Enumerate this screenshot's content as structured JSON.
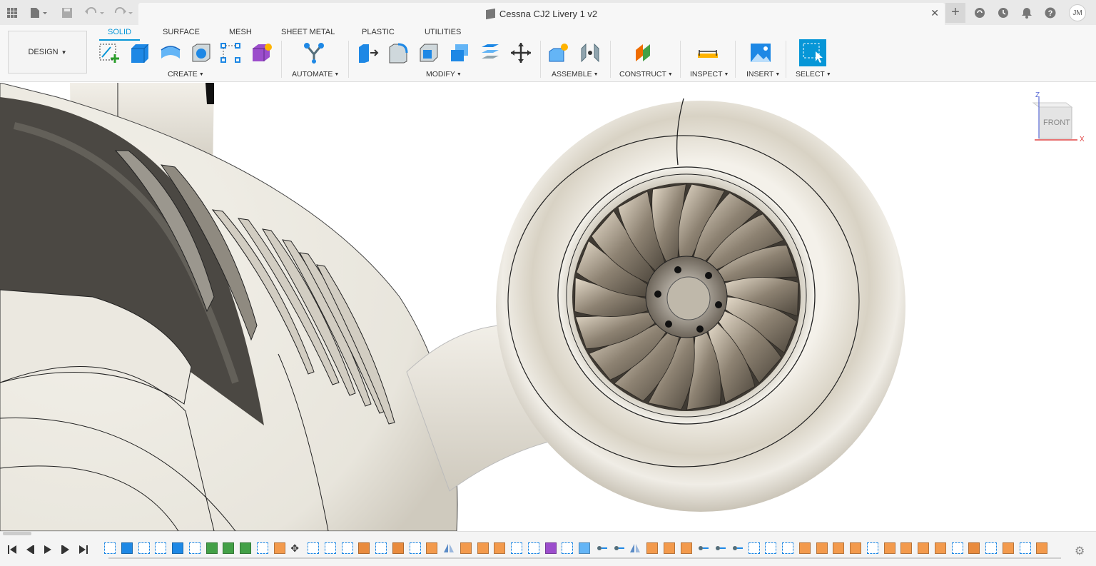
{
  "titlebar": {
    "doc_title": "Cessna CJ2 Livery 1 v2",
    "close_glyph": "✕",
    "new_tab_glyph": "+",
    "user_initials": "JM",
    "icons": [
      "app-grid-icon",
      "file-icon",
      "save-icon",
      "undo-icon",
      "redo-icon",
      "extensions-icon",
      "job-status-icon",
      "notifications-icon",
      "help-icon"
    ]
  },
  "toolbar": {
    "workspace_label": "DESIGN",
    "tabs": [
      {
        "label": "SOLID",
        "active": true
      },
      {
        "label": "SURFACE",
        "active": false
      },
      {
        "label": "MESH",
        "active": false
      },
      {
        "label": "SHEET METAL",
        "active": false
      },
      {
        "label": "PLASTIC",
        "active": false
      },
      {
        "label": "UTILITIES",
        "active": false
      }
    ],
    "groups": {
      "create": "CREATE",
      "automate": "AUTOMATE",
      "modify": "MODIFY",
      "assemble": "ASSEMBLE",
      "construct": "CONSTRUCT",
      "inspect": "INSPECT",
      "insert": "INSERT",
      "select": "SELECT"
    },
    "accent_color": "#0696d7"
  },
  "viewcube": {
    "face_label": "FRONT",
    "axis_z": "Z",
    "axis_x": "X"
  },
  "timeline": {
    "controls": [
      "skip-to-start-icon",
      "step-back-icon",
      "play-icon",
      "step-forward-icon",
      "skip-to-end-icon"
    ],
    "feature_count": 56
  }
}
